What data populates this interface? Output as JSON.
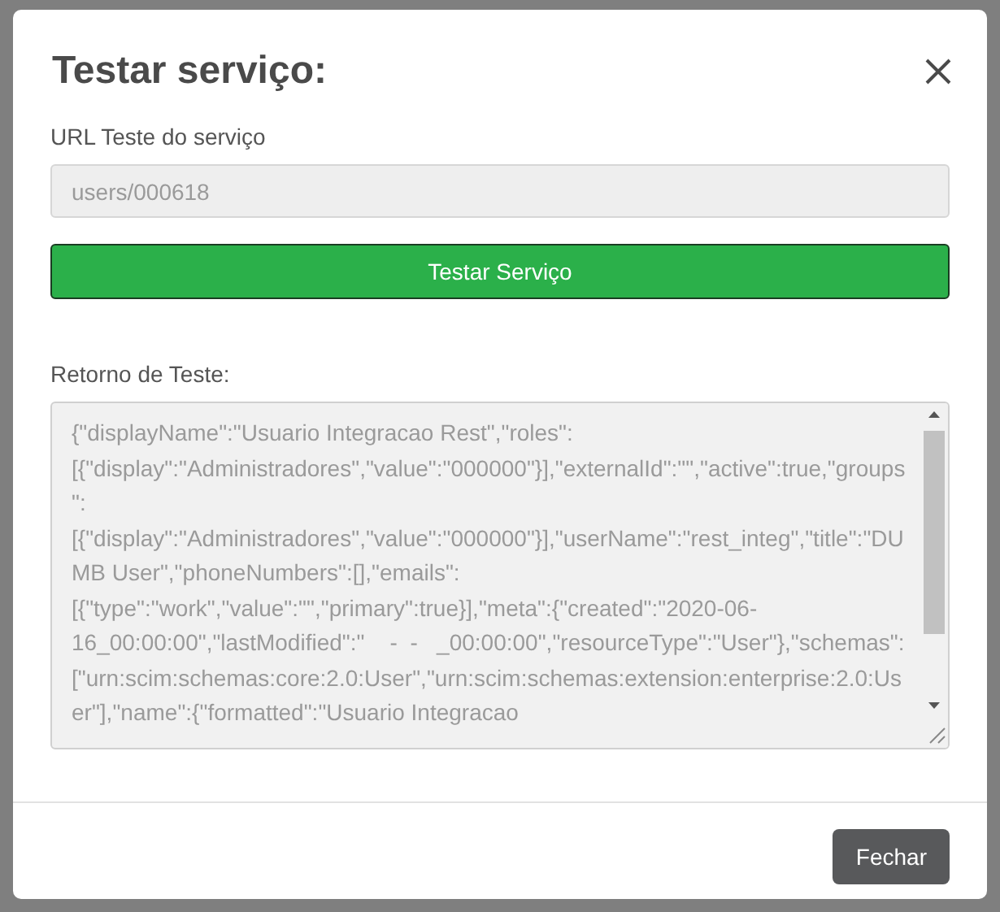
{
  "dialog": {
    "title": "Testar serviço:",
    "url_field": {
      "label": "URL Teste do serviço",
      "value": "users/000618",
      "disabled": true
    },
    "test_button": "Testar Serviço",
    "result": {
      "label": "Retorno de Teste:",
      "value": "{\"displayName\":\"Usuario Integracao Rest\",\"roles\":[{\"display\":\"Administradores\",\"value\":\"000000\"}],\"externalId\":\"\",\"active\":true,\"groups\":[{\"display\":\"Administradores\",\"value\":\"000000\"}],\"userName\":\"rest_integ\",\"title\":\"DUMB User\",\"phoneNumbers\":[],\"emails\":[{\"type\":\"work\",\"value\":\"\",\"primary\":true}],\"meta\":{\"created\":\"2020-06-16_00:00:00\",\"lastModified\":\"    -  -   _00:00:00\",\"resourceType\":\"User\"},\"schemas\":[\"urn:scim:schemas:core:2.0:User\",\"urn:scim:schemas:extension:enterprise:2.0:User\"],\"name\":{\"formatted\":\"Usuario Integracao"
    },
    "footer_button": "Fechar"
  }
}
